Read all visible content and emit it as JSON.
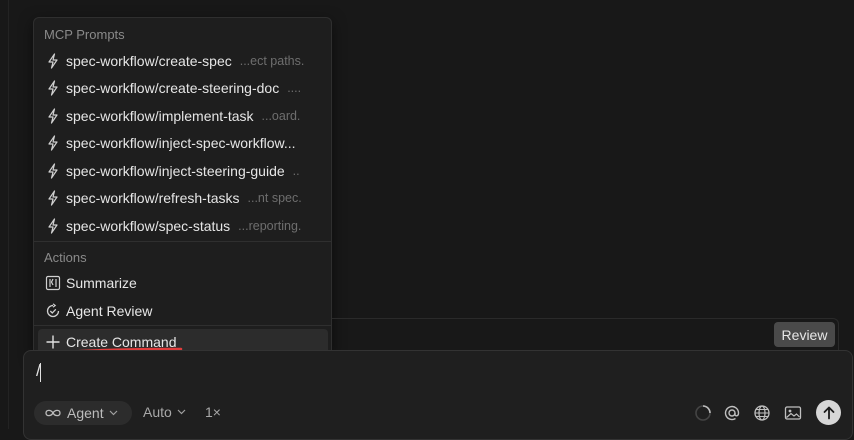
{
  "popup": {
    "mcp_title": "MCP Prompts",
    "mcp_items": [
      {
        "label": "spec-workflow/create-spec",
        "desc": "...ect paths."
      },
      {
        "label": "spec-workflow/create-steering-doc",
        "desc": "...."
      },
      {
        "label": "spec-workflow/implement-task",
        "desc": "...oard."
      },
      {
        "label": "spec-workflow/inject-spec-workflow...",
        "desc": ""
      },
      {
        "label": "spec-workflow/inject-steering-guide",
        "desc": ".."
      },
      {
        "label": "spec-workflow/refresh-tasks",
        "desc": "...nt spec."
      },
      {
        "label": "spec-workflow/spec-status",
        "desc": "...reporting."
      }
    ],
    "actions_title": "Actions",
    "actions": [
      {
        "label": "Summarize",
        "icon": "summarize-icon"
      },
      {
        "label": "Agent Review",
        "icon": "agent-review-icon"
      }
    ],
    "create_command": {
      "label": "Create Command",
      "icon": "plus-icon"
    }
  },
  "review": {
    "label": "Review"
  },
  "composer": {
    "input_value": "/",
    "agent_label": "Agent",
    "model_label": "Auto",
    "multiplier": "1×"
  },
  "colors": {
    "background": "#181818",
    "accent_underline": "#e03c3c",
    "send_button": "#d6d6d6"
  }
}
